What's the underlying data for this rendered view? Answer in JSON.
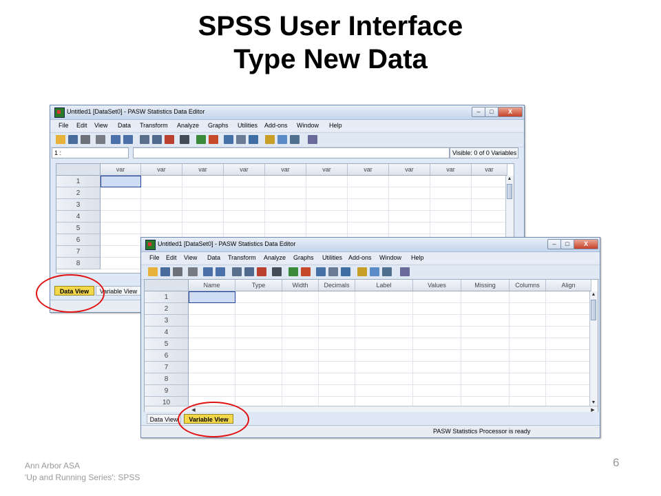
{
  "slide": {
    "title_line1": "SPSS User Interface",
    "title_line2": "Type New Data",
    "footer_line1": "Ann Arbor ASA",
    "footer_line2": "'Up and Running Series': SPSS",
    "page_number": "6"
  },
  "data_view_window": {
    "title": "Untitled1 [DataSet0] - PASW Statistics Data Editor",
    "menu": [
      "File",
      "Edit",
      "View",
      "Data",
      "Transform",
      "Analyze",
      "Graphs",
      "Utilities",
      "Add-ons",
      "Window",
      "Help"
    ],
    "cell_reference": "1 :",
    "visible_status": "Visible: 0 of 0 Variables",
    "column_headers": [
      "var",
      "var",
      "var",
      "var",
      "var",
      "var",
      "var",
      "var",
      "var",
      "var"
    ],
    "row_numbers": [
      "1",
      "2",
      "3",
      "4",
      "5",
      "6",
      "7",
      "8"
    ],
    "tabs": {
      "data_view": "Data View",
      "variable_view": "Variable View"
    }
  },
  "variable_view_window": {
    "title": "Untitled1 [DataSet0] - PASW Statistics Data Editor",
    "menu": [
      "File",
      "Edit",
      "View",
      "Data",
      "Transform",
      "Analyze",
      "Graphs",
      "Utilities",
      "Add-ons",
      "Window",
      "Help"
    ],
    "column_headers": [
      "Name",
      "Type",
      "Width",
      "Decimals",
      "Label",
      "Values",
      "Missing",
      "Columns",
      "Align"
    ],
    "row_numbers": [
      "1",
      "2",
      "3",
      "4",
      "5",
      "6",
      "7",
      "8",
      "9",
      "10"
    ],
    "tabs": {
      "data_view": "Data View",
      "variable_view": "Variable View"
    },
    "status": "PASW Statistics  Processor is ready"
  },
  "window_controls": {
    "minimize": "–",
    "maximize": "□",
    "close": "X"
  },
  "colors": {
    "highlight_ring": "#e01010",
    "active_tab": "#f5d84a",
    "selected_cell": "#cfdcf3"
  }
}
